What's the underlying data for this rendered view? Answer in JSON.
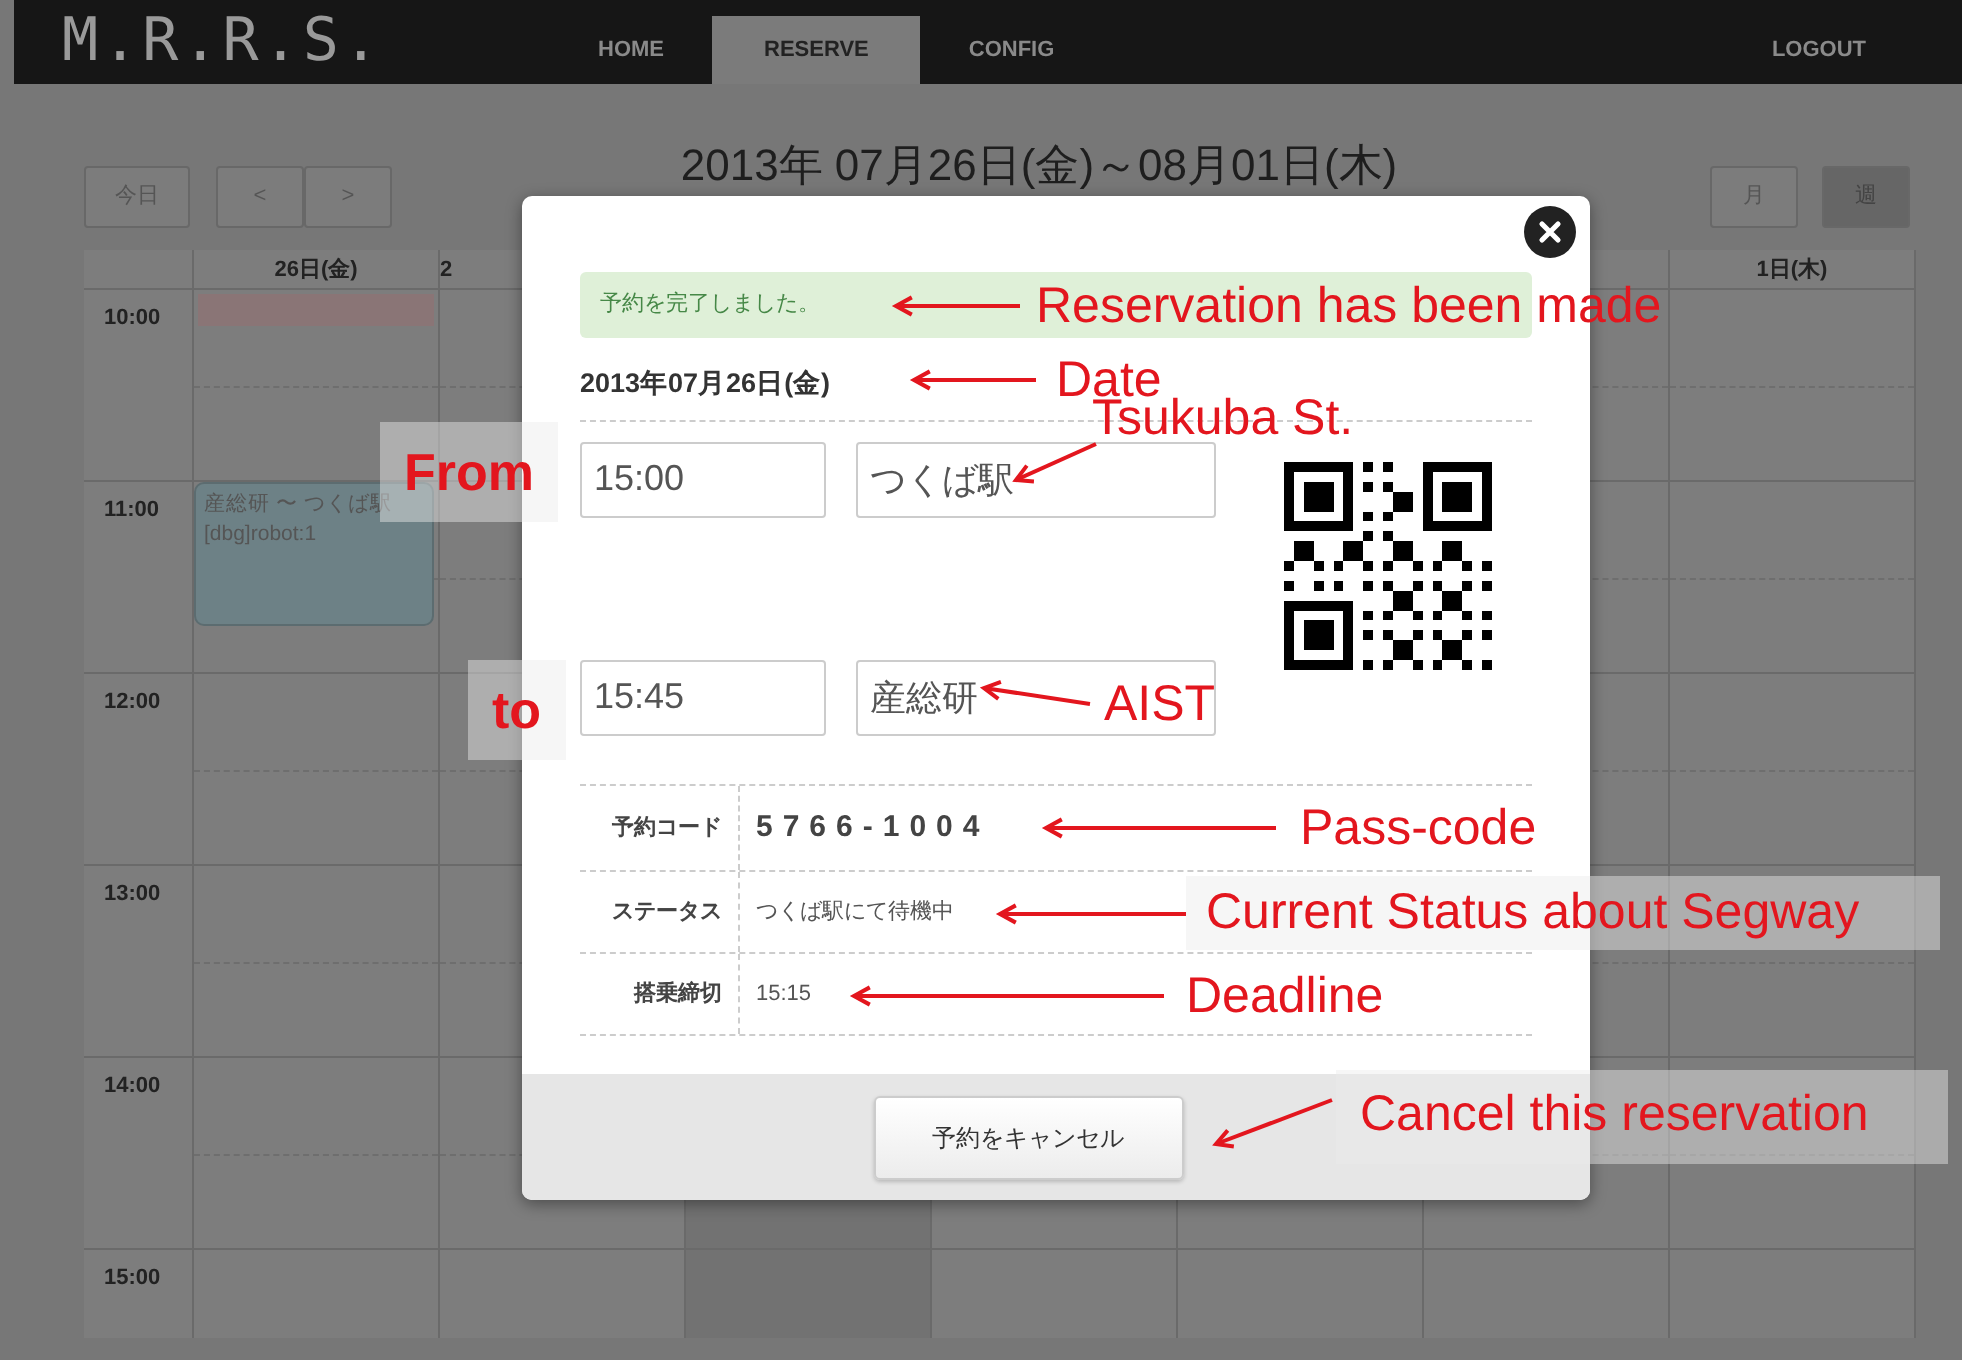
{
  "navbar": {
    "logo": "M.R.R.S.",
    "tabs": [
      {
        "label": "HOME",
        "selected": false
      },
      {
        "label": "RESERVE",
        "selected": true
      },
      {
        "label": "CONFIG",
        "selected": false
      }
    ],
    "logout": "LOGOUT"
  },
  "calendar": {
    "today_button": "今日",
    "prev_button": "<",
    "next_button": ">",
    "title": "2013年 07月26日(金)～08月01日(木)",
    "views": [
      {
        "label": "月",
        "selected": false
      },
      {
        "label": "週",
        "selected": true
      }
    ],
    "day_headers_left": [
      "26日(金)",
      "2"
    ],
    "day_header_right": "1日(木)",
    "time_labels": [
      "10:00",
      "11:00",
      "12:00",
      "13:00",
      "14:00",
      "15:00"
    ],
    "event": {
      "title": "産総研 〜 つくば駅",
      "detail": "[dbg]robot:1"
    }
  },
  "dialog": {
    "alert": "予約を完了しました。",
    "date": "2013年07月26日(金)",
    "from": {
      "time": "15:00",
      "place": "つくば駅"
    },
    "to": {
      "time": "15:45",
      "place": "産総研"
    },
    "details": [
      {
        "label": "予約コード",
        "value": "5766-1004",
        "kind": "code"
      },
      {
        "label": "ステータス",
        "value": "つくば駅にて待機中",
        "kind": "text"
      },
      {
        "label": "搭乗締切",
        "value": "15:15",
        "kind": "text"
      }
    ],
    "cancel_button": "予約をキャンセル"
  },
  "annotations": [
    {
      "text": "Reservation has been made",
      "boxed": false
    },
    {
      "text": "Date",
      "boxed": false
    },
    {
      "text": "Tsukuba St.",
      "boxed": false
    },
    {
      "text": "From",
      "boxed": true
    },
    {
      "text": "to",
      "boxed": true
    },
    {
      "text": "AIST",
      "boxed": false
    },
    {
      "text": "Pass-code",
      "boxed": false
    },
    {
      "text": "Current Status about Segway",
      "boxed": true
    },
    {
      "text": "Deadline",
      "boxed": false
    },
    {
      "text": "Cancel this reservation",
      "boxed": true
    }
  ]
}
